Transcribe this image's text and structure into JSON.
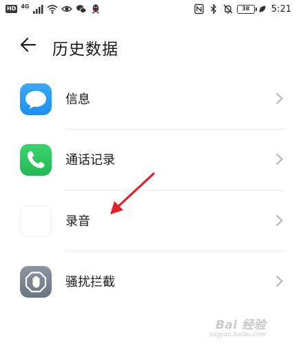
{
  "status_bar": {
    "hd_label": "HD",
    "network_label": "4G",
    "battery_level": "38",
    "time": "5:21"
  },
  "header": {
    "title": "历史数据"
  },
  "list": {
    "items": [
      {
        "label": "信息",
        "icon": "message-icon"
      },
      {
        "label": "通话记录",
        "icon": "phone-icon"
      },
      {
        "label": "录音",
        "icon": "voice-recorder-icon"
      },
      {
        "label": "骚扰拦截",
        "icon": "harassment-block-icon"
      }
    ]
  },
  "watermark": {
    "brand": "Bai 经验",
    "site": "jingyan.baidu.com"
  },
  "colors": {
    "message": "#2a9df4",
    "phone": "#2cc55f",
    "block": "#7a8290",
    "annotation_arrow": "#e0202b"
  }
}
